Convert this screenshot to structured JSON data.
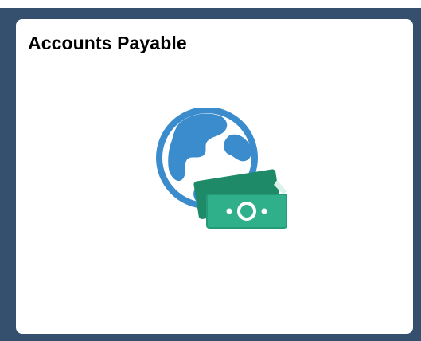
{
  "tile": {
    "title": "Accounts Payable",
    "icon": "globe-money-icon"
  },
  "colors": {
    "frame": "#35506e",
    "tile_background": "#ffffff",
    "globe": "#3b8ccc",
    "money": "#2fb08a",
    "money_dark": "#1e8a68"
  }
}
